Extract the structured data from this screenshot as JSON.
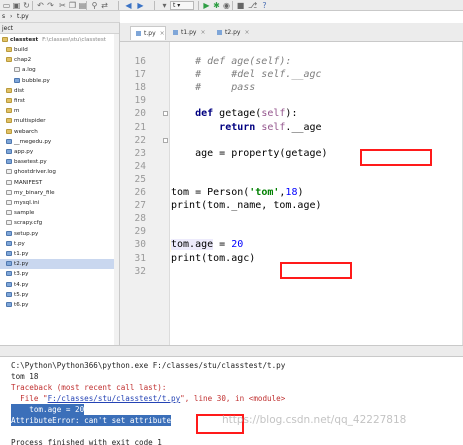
{
  "colors": {
    "annotation_box": "#ff1a1a",
    "keyword": "#000080",
    "string": "#008000",
    "number": "#0000ff",
    "comment": "#7f7f7f",
    "error": "#c03030",
    "selection": "#3b6fb9"
  },
  "toolbar": {
    "icons": [
      "folder-icon",
      "save-icon",
      "sync-icon",
      "undo-icon",
      "redo-icon",
      "cut-icon",
      "copy-icon",
      "paste-icon",
      "find-icon",
      "replace-icon",
      "back-icon",
      "forward-icon",
      "run-config-icon",
      "run-icon",
      "debug-icon",
      "coverage-icon",
      "stop-icon",
      "vcs-icon",
      "help-icon"
    ],
    "run_config": "t"
  },
  "breadcrumb": {
    "project": "s",
    "file": "t.py"
  },
  "project_panel": {
    "header": "ject",
    "root": {
      "name": "classtest",
      "path": "F:\\classes\\stu\\classtest"
    },
    "items": [
      {
        "label": "build",
        "type": "folder"
      },
      {
        "label": "chap2",
        "type": "folder"
      },
      {
        "label": "a.log",
        "type": "text"
      },
      {
        "label": "bubble.py",
        "type": "file"
      },
      {
        "label": "dist",
        "type": "folder"
      },
      {
        "label": "first",
        "type": "folder"
      },
      {
        "label": "m",
        "type": "folder"
      },
      {
        "label": "multispider",
        "type": "folder"
      },
      {
        "label": "webarch",
        "type": "folder"
      },
      {
        "label": "__megedu.py",
        "type": "file"
      },
      {
        "label": "app.py",
        "type": "file"
      },
      {
        "label": "basetest.py",
        "type": "file"
      },
      {
        "label": "ghostdriver.log",
        "type": "text"
      },
      {
        "label": "MANIFEST",
        "type": "text"
      },
      {
        "label": "my_binary_file",
        "type": "text"
      },
      {
        "label": "mysql.ini",
        "type": "text"
      },
      {
        "label": "sample",
        "type": "text"
      },
      {
        "label": "scrapy.cfg",
        "type": "text"
      },
      {
        "label": "setup.py",
        "type": "file"
      },
      {
        "label": "t.py",
        "type": "file"
      },
      {
        "label": "t1.py",
        "type": "file"
      },
      {
        "label": "t2.py",
        "type": "file"
      },
      {
        "label": "t3.py",
        "type": "file"
      },
      {
        "label": "t4.py",
        "type": "file"
      },
      {
        "label": "t5.py",
        "type": "file"
      },
      {
        "label": "t6.py",
        "type": "file"
      }
    ],
    "selected": "t2.py"
  },
  "tabs": [
    {
      "label": "t.py",
      "active": true
    },
    {
      "label": "t1.py",
      "active": false
    },
    {
      "label": "t2.py",
      "active": false
    }
  ],
  "editor": {
    "lines": [
      {
        "num": "16",
        "text": "    # def age(self):"
      },
      {
        "num": "17",
        "text": "    #     #del self.__agc"
      },
      {
        "num": "18",
        "text": "    #     pass"
      },
      {
        "num": "19",
        "text": ""
      },
      {
        "num": "20",
        "text": "    def getage(self):"
      },
      {
        "num": "21",
        "text": "        return self.__age"
      },
      {
        "num": "22",
        "text": ""
      },
      {
        "num": "23",
        "text": "    age = property(getage)"
      },
      {
        "num": "24",
        "text": ""
      },
      {
        "num": "25",
        "text": ""
      },
      {
        "num": "26",
        "text": "tom = Person('tom',18)"
      },
      {
        "num": "27",
        "text": "print(tom._name, tom.age)"
      },
      {
        "num": "28",
        "text": ""
      },
      {
        "num": "29",
        "text": ""
      },
      {
        "num": "30",
        "text": "tom.age = 20"
      },
      {
        "num": "31",
        "text": "print(tom.agc)"
      },
      {
        "num": "32",
        "text": ""
      }
    ]
  },
  "console": {
    "lines": [
      {
        "text": "C:\\Python\\Python366\\python.exe F:/classes/stu/classtest/t.py",
        "kind": "normal"
      },
      {
        "text": "tom 18",
        "kind": "normal"
      },
      {
        "text": "Traceback (most recent call last):",
        "kind": "error"
      },
      {
        "text": "  File \"F:/classes/stu/classtest/t.py\", line 30, in <module>",
        "kind": "error"
      },
      {
        "text": "    tom.age = 20",
        "kind": "selected"
      },
      {
        "text": "AttributeError: can't set attribute",
        "kind": "selected"
      },
      {
        "text": "",
        "kind": "normal"
      },
      {
        "text": "Process finished with exit code 1",
        "kind": "normal"
      }
    ],
    "watermark": "https://blog.csdn.net/qq_42227818"
  }
}
